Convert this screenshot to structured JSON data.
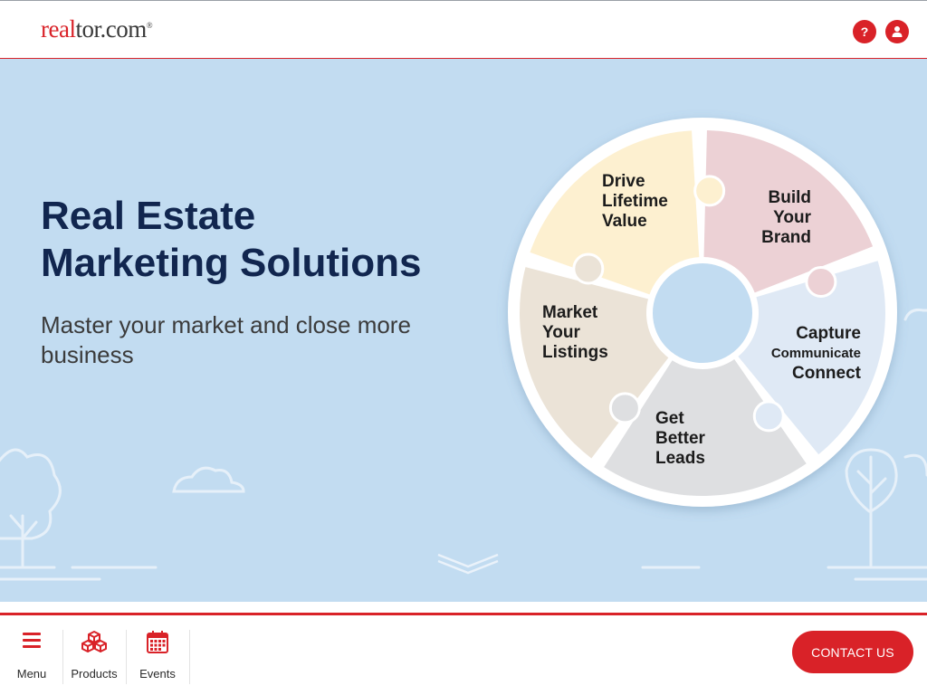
{
  "header": {
    "logo": {
      "part1": "real",
      "part2": "tor.com",
      "reg": "®"
    },
    "help_label": "?"
  },
  "hero": {
    "title_line1": "Real Estate",
    "title_line2": "Marketing Solutions",
    "subtitle": "Master your market and close more business"
  },
  "wheel": {
    "segments": [
      {
        "lines": [
          "Drive",
          "Lifetime",
          "Value"
        ],
        "color": "#ecd1d5"
      },
      {
        "lines": [
          "Build",
          "Your",
          "Brand"
        ],
        "color": "#dfe9f5"
      },
      {
        "lines": [
          "Capture",
          "Communicate",
          "Connect"
        ],
        "color": "#dedfe1"
      },
      {
        "lines": [
          "Get",
          "Better",
          "Leads"
        ],
        "color": "#ebe3d7"
      },
      {
        "lines": [
          "Market",
          "Your",
          "Listings"
        ],
        "color": "#fdf0d0"
      }
    ],
    "center_color": "#c2dcf1"
  },
  "footer": {
    "nav": [
      {
        "label": "Menu",
        "icon": "hamburger-icon"
      },
      {
        "label": "Products",
        "icon": "cubes-icon"
      },
      {
        "label": "Events",
        "icon": "calendar-icon"
      }
    ],
    "contact_label": "CONTACT US"
  },
  "colors": {
    "brand_red": "#d92228",
    "navy": "#11264f",
    "hero_bg": "#c2dcf1"
  }
}
